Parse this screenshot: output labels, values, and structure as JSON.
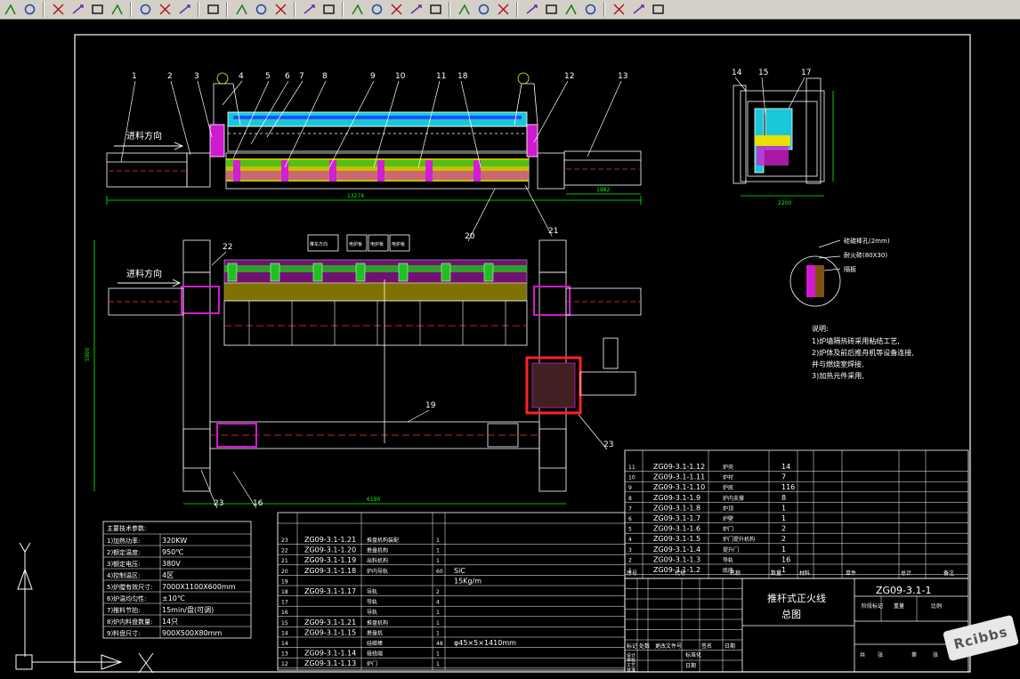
{
  "toolbar": {
    "buttons": [
      {
        "name": "object-snap-icon"
      },
      {
        "name": "polar-tracking-icon"
      },
      {
        "name": "snap-grid-icon"
      },
      {
        "name": "filter-icon"
      },
      {
        "name": "triangle-snap-icon"
      },
      {
        "name": "coordinate-icon"
      },
      {
        "name": "dimension-center-icon"
      },
      {
        "name": "corner-icon"
      },
      {
        "name": "ucs-icon"
      },
      {
        "name": "layer-manager-icon"
      },
      {
        "name": "pick-point-icon"
      },
      {
        "name": "paste-block-icon"
      },
      {
        "name": "edit-icon"
      },
      {
        "name": "line-dash-icon"
      },
      {
        "name": "line-corner-icon"
      },
      {
        "name": "line-icon"
      },
      {
        "name": "line-snap-icon"
      },
      {
        "name": "cross-line-icon"
      },
      {
        "name": "cross-x-icon"
      },
      {
        "name": "offset-line-icon"
      },
      {
        "name": "circle-icon"
      },
      {
        "name": "circle-tangent-icon"
      },
      {
        "name": "circle-arc-icon"
      },
      {
        "name": "perpendicular-icon"
      },
      {
        "name": "parallel-icon"
      },
      {
        "name": "insert-block-icon"
      },
      {
        "name": "node-icon"
      },
      {
        "name": "nearest-icon"
      },
      {
        "name": "close-icon"
      },
      {
        "name": "magnet-icon"
      }
    ]
  },
  "drawing": {
    "callouts_top": [
      "1",
      "2",
      "3",
      "4",
      "5",
      "6",
      "7",
      "8",
      "9",
      "10",
      "11",
      "18",
      "12",
      "13",
      "14",
      "15",
      "17"
    ],
    "callouts_bottom": [
      "20",
      "21"
    ],
    "callouts_plan": [
      "22",
      "19",
      "23",
      "23",
      "16"
    ],
    "feed_direction": "进料方向",
    "legend_boxes": [
      "推车方向",
      "电炉板",
      "电炉板",
      "电炉板"
    ],
    "dimensions": {
      "top_length": "13274",
      "top_right": "1982",
      "side_width": "2200",
      "plan_width": "6190",
      "plan_height": "5900"
    },
    "detail": {
      "labels": [
        "硅碳棒孔(2mm)",
        "耐火砖(80X30)",
        "隔板"
      ]
    },
    "notes": {
      "title": "说明:",
      "lines": [
        "1)炉墙隔热砖采用粘结工艺,",
        "2)炉体及前后推舟机等设备连接,",
        "并与燃烧室焊接,",
        "3)加热元件采用,"
      ]
    },
    "tech_params": {
      "title": "主要技术参数:",
      "rows": [
        {
          "label": "1)加热功率:",
          "value": "320KW"
        },
        {
          "label": "2)额定温度:",
          "value": "950℃"
        },
        {
          "label": "3)额定电压:",
          "value": "380V"
        },
        {
          "label": "4)控制温区:",
          "value": "4区"
        },
        {
          "label": "5)炉膛有效尺寸:",
          "value": "7000X1100X600mm"
        },
        {
          "label": "6)炉温均匀性:",
          "value": "±10℃"
        },
        {
          "label": "7)推料节拍:",
          "value": "15min/盘(可调)"
        },
        {
          "label": "8)炉内料盘数量:",
          "value": "14只"
        },
        {
          "label": "9)料盘尺寸:",
          "value": "900X500X80mm"
        }
      ]
    },
    "bom_left": {
      "rows": [
        {
          "no": "23",
          "code": "ZG09-3.1-1.21",
          "name": "推盘机构装配",
          "qty": "1",
          "material": ""
        },
        {
          "no": "22",
          "code": "ZG09-3.1-1.20",
          "name": "推盘机构",
          "qty": "1",
          "material": ""
        },
        {
          "no": "21",
          "code": "ZG09-3.1-1.19",
          "name": "出料机构",
          "qty": "1",
          "material": ""
        },
        {
          "no": "20",
          "code": "ZG09-3.1-1.18",
          "name": "炉内导轨",
          "qty": "60",
          "material": "SiC"
        },
        {
          "no": "19",
          "code": "",
          "name": "",
          "qty": "",
          "material": "15Kg/m"
        },
        {
          "no": "18",
          "code": "ZG09-3.1-1.17",
          "name": "导轨",
          "qty": "2",
          "material": ""
        },
        {
          "no": "17",
          "code": "",
          "name": "导轨",
          "qty": "4",
          "material": ""
        },
        {
          "no": "16",
          "code": "",
          "name": "导轨",
          "qty": "1",
          "material": ""
        },
        {
          "no": "15",
          "code": "ZG09-3.1-1.21",
          "name": "推盘机构",
          "qty": "1",
          "material": ""
        },
        {
          "no": "14",
          "code": "ZG09-3.1-1.15",
          "name": "推盘机",
          "qty": "1",
          "material": ""
        },
        {
          "no": "14",
          "code": "",
          "name": "硅碳棒",
          "qty": "48",
          "material": "φ45×5×1410mm"
        },
        {
          "no": "13",
          "code": "ZG09-3.1-1.14",
          "name": "接线端",
          "qty": "1",
          "material": ""
        },
        {
          "no": "12",
          "code": "ZG09-3.1-1.13",
          "name": "炉门",
          "qty": "1",
          "material": ""
        }
      ]
    },
    "bom_right": {
      "rows": [
        {
          "no": "11",
          "code": "ZG09-3.1-1.12",
          "name": "炉壳",
          "qty": "14"
        },
        {
          "no": "10",
          "code": "ZG09-3.1-1.11",
          "name": "炉衬",
          "qty": "7"
        },
        {
          "no": "9",
          "code": "ZG09-3.1-1.10",
          "name": "炉底",
          "qty": "116"
        },
        {
          "no": "8",
          "code": "ZG09-3.1-1.9",
          "name": "炉内支撑",
          "qty": "8"
        },
        {
          "no": "7",
          "code": "ZG09-3.1-1.8",
          "name": "炉顶",
          "qty": "1"
        },
        {
          "no": "6",
          "code": "ZG09-3.1-1.7",
          "name": "炉壁",
          "qty": "1"
        },
        {
          "no": "5",
          "code": "ZG09-3.1-1.6",
          "name": "炉门",
          "qty": "2"
        },
        {
          "no": "4",
          "code": "ZG09-3.1-1.5",
          "name": "炉门提升机构",
          "qty": "2"
        },
        {
          "no": "3",
          "code": "ZG09-3.1-1.4",
          "name": "提升门",
          "qty": "1"
        },
        {
          "no": "2",
          "code": "ZG09-3.1-1.3",
          "name": "导轨",
          "qty": "16"
        },
        {
          "no": "1",
          "code": "ZG09-3.1-1.2",
          "name": "底座",
          "qty": "1"
        }
      ],
      "header": [
        "序号",
        "代号",
        "名称",
        "数量",
        "材料",
        "单件",
        "总计",
        "备注"
      ]
    },
    "title_block": {
      "drawing_name_line1": "推杆式正火线",
      "drawing_name_line2": "总图",
      "drawing_no": "ZG09-3.1-1",
      "stage_labels": [
        "阶段标记",
        "重量",
        "比例"
      ],
      "sheet_labels": [
        "共",
        "张",
        "第",
        "张"
      ],
      "sign_labels": [
        "标记",
        "处数",
        "更改文件号",
        "签名",
        "日期"
      ],
      "role_labels": [
        "设计",
        "审核",
        "工艺",
        "批准"
      ],
      "std_labels": [
        "标准化",
        "日期"
      ]
    },
    "ucs": {
      "y_label": "Y",
      "x_label": "X"
    }
  },
  "watermark": "Rcibbs"
}
